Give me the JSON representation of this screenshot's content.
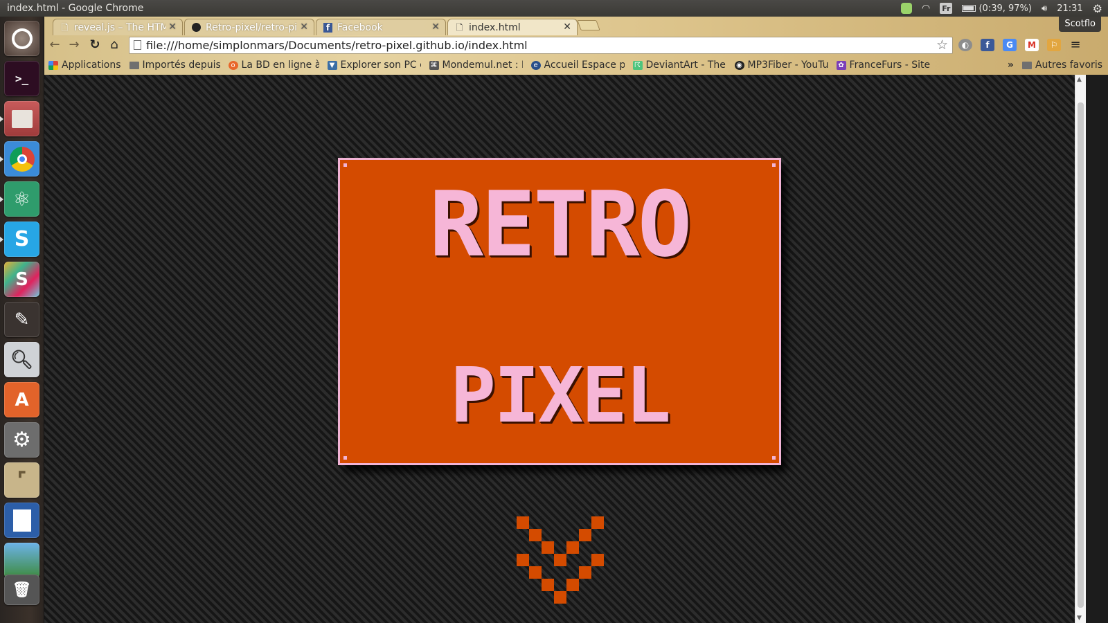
{
  "system": {
    "window_title": "index.html - Google Chrome",
    "battery": "(0:39, 97%)",
    "clock": "21:31",
    "keyboard": "Fr"
  },
  "launcher": {
    "items": [
      "ubuntu-dash",
      "terminal",
      "files",
      "chrome",
      "atom",
      "skype",
      "slack",
      "paint-brush",
      "image-viewer",
      "software-center",
      "system-settings",
      "text-editor",
      "writer",
      "image-editor",
      "trash"
    ]
  },
  "chrome": {
    "profile": "Scotflo",
    "tabs": [
      {
        "label": "reveal.js – The HTML",
        "active": false
      },
      {
        "label": "Retro-pixel/retro-pi",
        "active": false
      },
      {
        "label": "Facebook",
        "active": false
      },
      {
        "label": "index.html",
        "active": true
      }
    ],
    "url": "file:///home/simplonmars/Documents/retro-pixel.github.io/index.html",
    "bookmarks": [
      {
        "label": "Applications"
      },
      {
        "label": "Importés depuis"
      },
      {
        "label": "La BD en ligne à l"
      },
      {
        "label": "Explorer son PC e"
      },
      {
        "label": "Mondemul.net : L"
      },
      {
        "label": "Accueil Espace pe"
      },
      {
        "label": "DeviantArt - The l"
      },
      {
        "label": "MP3Fiber - YouTu"
      },
      {
        "label": "FranceFurs - Site"
      }
    ],
    "bookmarks_more": "»",
    "other_bookmarks": "Autres favoris"
  },
  "page": {
    "title_line_1": "RETRO",
    "title_line_2": "PIXEL",
    "colors": {
      "card": "#d44b00",
      "text": "#f6b6d7",
      "border": "#f2b4d6"
    }
  }
}
